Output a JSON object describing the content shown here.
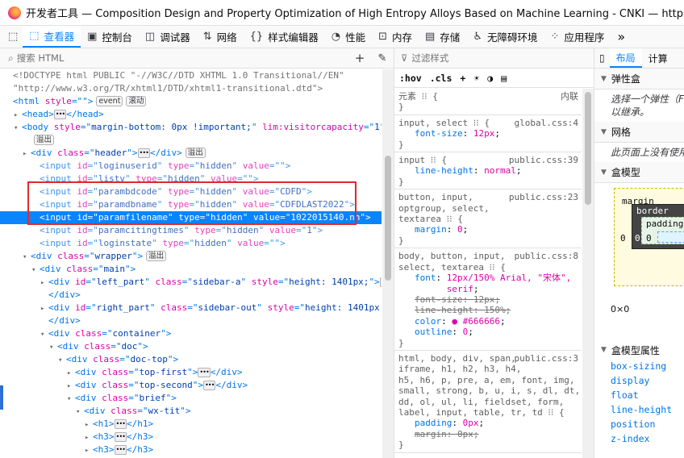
{
  "window": {
    "title": "开发者工具 — Composition Design and Property Optimization of High Entropy Alloys Based on Machine Learning - CNKI — https://ov..."
  },
  "toolbar": {
    "tabs": [
      {
        "label": "查看器",
        "icon": "inspector-icon",
        "active": true
      },
      {
        "label": "控制台",
        "icon": "console-icon"
      },
      {
        "label": "调试器",
        "icon": "debugger-icon"
      },
      {
        "label": "网络",
        "icon": "network-icon"
      },
      {
        "label": "样式编辑器",
        "icon": "style-editor-icon"
      },
      {
        "label": "性能",
        "icon": "performance-icon"
      },
      {
        "label": "内存",
        "icon": "memory-icon"
      },
      {
        "label": "存储",
        "icon": "storage-icon"
      },
      {
        "label": "无障碍环境",
        "icon": "accessibility-icon"
      },
      {
        "label": "应用程序",
        "icon": "application-icon"
      }
    ],
    "overflow": "»"
  },
  "inspector": {
    "search_placeholder": "搜索 HTML",
    "add": "+",
    "lines": [
      {
        "indent": 0,
        "tw": "",
        "parts": [
          [
            "gray",
            "<!DOCTYPE html PUBLIC \"-//W3C//DTD XHTML 1.0 Transitional//EN\""
          ]
        ]
      },
      {
        "indent": 0,
        "tw": "",
        "parts": [
          [
            "gray",
            "\"http://www.w3.org/TR/xhtml1/DTD/xhtml1-transitional.dtd\">"
          ]
        ]
      },
      {
        "indent": 0,
        "tw": "",
        "parts": [
          [
            "tn",
            "<html "
          ],
          [
            "an",
            "style"
          ],
          [
            "tn",
            "=\""
          ],
          [
            "av",
            ""
          ],
          [
            "tn",
            "\">"
          ]
        ],
        "badges": [
          "event",
          "滚动"
        ]
      },
      {
        "indent": 1,
        "tw": "▸",
        "parts": [
          [
            "tn",
            "<head>"
          ]
        ],
        "ell": true,
        "after": [
          [
            "tn",
            "</head>"
          ]
        ]
      },
      {
        "indent": 1,
        "tw": "▾",
        "parts": [
          [
            "tn",
            "<body "
          ],
          [
            "an",
            "style"
          ],
          [
            "tn",
            "=\""
          ],
          [
            "av",
            "margin-bottom: 0px !important;"
          ],
          [
            "tn",
            "\" "
          ],
          [
            "an",
            "lim:visitorcapacity"
          ],
          [
            "tn",
            "=\""
          ],
          [
            "av",
            "1"
          ],
          [
            "tn",
            "\">"
          ]
        ]
      },
      {
        "indent": 2,
        "tw": "",
        "parts": [],
        "badges": [
          "溢出"
        ]
      },
      {
        "indent": 2,
        "tw": "▸",
        "parts": [
          [
            "tn",
            "<div "
          ],
          [
            "an",
            "class"
          ],
          [
            "tn",
            "=\""
          ],
          [
            "av",
            "header"
          ],
          [
            "tn",
            "\">"
          ]
        ],
        "ell": true,
        "after": [
          [
            "tn",
            "</div>"
          ]
        ],
        "badges": [
          "溢出"
        ]
      },
      {
        "indent": 3,
        "tw": "",
        "hid": true,
        "parts": [
          [
            "tn",
            "<input "
          ],
          [
            "an",
            "id"
          ],
          [
            "tn",
            "=\""
          ],
          [
            "av",
            "loginuserid"
          ],
          [
            "tn",
            "\" "
          ],
          [
            "an",
            "type"
          ],
          [
            "tn",
            "=\""
          ],
          [
            "av",
            "hidden"
          ],
          [
            "tn",
            "\" "
          ],
          [
            "an",
            "value"
          ],
          [
            "tn",
            "=\""
          ],
          [
            "av",
            ""
          ],
          [
            "tn",
            "\">"
          ]
        ]
      },
      {
        "indent": 3,
        "tw": "",
        "hid": true,
        "parts": [
          [
            "tn",
            "<input "
          ],
          [
            "an",
            "id"
          ],
          [
            "tn",
            "=\""
          ],
          [
            "av",
            "listv"
          ],
          [
            "tn",
            "\" "
          ],
          [
            "an",
            "type"
          ],
          [
            "tn",
            "=\""
          ],
          [
            "av",
            "hidden"
          ],
          [
            "tn",
            "\" "
          ],
          [
            "an",
            "value"
          ],
          [
            "tn",
            "=\""
          ],
          [
            "av",
            ""
          ],
          [
            "tn",
            "\">"
          ]
        ]
      },
      {
        "indent": 3,
        "tw": "",
        "hid": true,
        "parts": [
          [
            "tn",
            "<input "
          ],
          [
            "an",
            "id"
          ],
          [
            "tn",
            "=\""
          ],
          [
            "av",
            "parambdcode"
          ],
          [
            "tn",
            "\" "
          ],
          [
            "an",
            "type"
          ],
          [
            "tn",
            "=\""
          ],
          [
            "av",
            "hidden"
          ],
          [
            "tn",
            "\" "
          ],
          [
            "an",
            "value"
          ],
          [
            "tn",
            "=\""
          ],
          [
            "av",
            "CDFD"
          ],
          [
            "tn",
            "\">"
          ]
        ]
      },
      {
        "indent": 3,
        "tw": "",
        "hid": true,
        "parts": [
          [
            "tn",
            "<input "
          ],
          [
            "an",
            "id"
          ],
          [
            "tn",
            "=\""
          ],
          [
            "av",
            "paramdbname"
          ],
          [
            "tn",
            "\" "
          ],
          [
            "an",
            "type"
          ],
          [
            "tn",
            "=\""
          ],
          [
            "av",
            "hidden"
          ],
          [
            "tn",
            "\" "
          ],
          [
            "an",
            "value"
          ],
          [
            "tn",
            "=\""
          ],
          [
            "av",
            "CDFDLAST2022"
          ],
          [
            "tn",
            "\">"
          ]
        ]
      },
      {
        "indent": 3,
        "tw": "",
        "sel": true,
        "parts": [
          [
            "tn",
            "<input "
          ],
          [
            "an",
            "id"
          ],
          [
            "tn",
            "=\""
          ],
          [
            "av",
            "paramfilename"
          ],
          [
            "tn",
            "\" "
          ],
          [
            "an",
            "type"
          ],
          [
            "tn",
            "=\""
          ],
          [
            "av",
            "hidden"
          ],
          [
            "tn",
            "\" "
          ],
          [
            "an",
            "value"
          ],
          [
            "tn",
            "=\""
          ],
          [
            "av",
            "1022015140.nh"
          ],
          [
            "tn",
            "\">"
          ]
        ]
      },
      {
        "indent": 3,
        "tw": "",
        "hid": true,
        "parts": [
          [
            "tn",
            "<input "
          ],
          [
            "an",
            "id"
          ],
          [
            "tn",
            "=\""
          ],
          [
            "av",
            "paramcitingtimes"
          ],
          [
            "tn",
            "\" "
          ],
          [
            "an",
            "type"
          ],
          [
            "tn",
            "=\""
          ],
          [
            "av",
            "hidden"
          ],
          [
            "tn",
            "\" "
          ],
          [
            "an",
            "value"
          ],
          [
            "tn",
            "=\""
          ],
          [
            "av",
            "1"
          ],
          [
            "tn",
            "\">"
          ]
        ]
      },
      {
        "indent": 3,
        "tw": "",
        "hid": true,
        "parts": [
          [
            "tn",
            "<input "
          ],
          [
            "an",
            "id"
          ],
          [
            "tn",
            "=\""
          ],
          [
            "av",
            "loginstate"
          ],
          [
            "tn",
            "\" "
          ],
          [
            "an",
            "type"
          ],
          [
            "tn",
            "=\""
          ],
          [
            "av",
            "hidden"
          ],
          [
            "tn",
            "\" "
          ],
          [
            "an",
            "value"
          ],
          [
            "tn",
            "=\""
          ],
          [
            "av",
            ""
          ],
          [
            "tn",
            "\">"
          ]
        ]
      },
      {
        "indent": 2,
        "tw": "▾",
        "parts": [
          [
            "tn",
            "<div "
          ],
          [
            "an",
            "class"
          ],
          [
            "tn",
            "=\""
          ],
          [
            "av",
            "wrapper"
          ],
          [
            "tn",
            "\">"
          ]
        ],
        "badges": [
          "溢出"
        ]
      },
      {
        "indent": 3,
        "tw": "▾",
        "parts": [
          [
            "tn",
            "<div "
          ],
          [
            "an",
            "class"
          ],
          [
            "tn",
            "=\""
          ],
          [
            "av",
            "main"
          ],
          [
            "tn",
            "\">"
          ]
        ]
      },
      {
        "indent": 4,
        "tw": "▸",
        "parts": [
          [
            "tn",
            "<div "
          ],
          [
            "an",
            "id"
          ],
          [
            "tn",
            "=\""
          ],
          [
            "av",
            "left_part"
          ],
          [
            "tn",
            "\" "
          ],
          [
            "an",
            "class"
          ],
          [
            "tn",
            "=\""
          ],
          [
            "av",
            "sidebar-a"
          ],
          [
            "tn",
            "\" "
          ],
          [
            "an",
            "style"
          ],
          [
            "tn",
            "=\""
          ],
          [
            "av",
            "height: 1401px;"
          ],
          [
            "tn",
            "\">"
          ]
        ],
        "ell": true
      },
      {
        "indent": 4,
        "tw": "",
        "parts": [
          [
            "tn",
            "</div>"
          ]
        ]
      },
      {
        "indent": 4,
        "tw": "▸",
        "parts": [
          [
            "tn",
            "<div "
          ],
          [
            "an",
            "id"
          ],
          [
            "tn",
            "=\""
          ],
          [
            "av",
            "right_part"
          ],
          [
            "tn",
            "\" "
          ],
          [
            "an",
            "class"
          ],
          [
            "tn",
            "=\""
          ],
          [
            "av",
            "sidebar-out"
          ],
          [
            "tn",
            "\" "
          ],
          [
            "an",
            "style"
          ],
          [
            "tn",
            "=\""
          ],
          [
            "av",
            "height: 1401px;"
          ],
          [
            "tn",
            "\">"
          ]
        ],
        "ell": true
      },
      {
        "indent": 4,
        "tw": "",
        "parts": [
          [
            "tn",
            "</div>"
          ]
        ]
      },
      {
        "indent": 4,
        "tw": "▾",
        "parts": [
          [
            "tn",
            "<div "
          ],
          [
            "an",
            "class"
          ],
          [
            "tn",
            "=\""
          ],
          [
            "av",
            "container"
          ],
          [
            "tn",
            "\">"
          ]
        ]
      },
      {
        "indent": 5,
        "tw": "▾",
        "parts": [
          [
            "tn",
            "<div "
          ],
          [
            "an",
            "class"
          ],
          [
            "tn",
            "=\""
          ],
          [
            "av",
            "doc"
          ],
          [
            "tn",
            "\">"
          ]
        ]
      },
      {
        "indent": 6,
        "tw": "▾",
        "parts": [
          [
            "tn",
            "<div "
          ],
          [
            "an",
            "class"
          ],
          [
            "tn",
            "=\""
          ],
          [
            "av",
            "doc-top"
          ],
          [
            "tn",
            "\">"
          ]
        ]
      },
      {
        "indent": 7,
        "tw": "▸",
        "parts": [
          [
            "tn",
            "<div "
          ],
          [
            "an",
            "class"
          ],
          [
            "tn",
            "=\""
          ],
          [
            "av",
            "top-first"
          ],
          [
            "tn",
            "\">"
          ]
        ],
        "ell": true,
        "after": [
          [
            "tn",
            "</div>"
          ]
        ]
      },
      {
        "indent": 7,
        "tw": "▸",
        "parts": [
          [
            "tn",
            "<div "
          ],
          [
            "an",
            "class"
          ],
          [
            "tn",
            "=\""
          ],
          [
            "av",
            "top-second"
          ],
          [
            "tn",
            "\">"
          ]
        ],
        "ell": true,
        "after": [
          [
            "tn",
            "</div>"
          ]
        ]
      },
      {
        "indent": 7,
        "tw": "▾",
        "parts": [
          [
            "tn",
            "<div "
          ],
          [
            "an",
            "class"
          ],
          [
            "tn",
            "=\""
          ],
          [
            "av",
            "brief"
          ],
          [
            "tn",
            "\">"
          ]
        ]
      },
      {
        "indent": 8,
        "tw": "▾",
        "parts": [
          [
            "tn",
            "<div "
          ],
          [
            "an",
            "class"
          ],
          [
            "tn",
            "=\""
          ],
          [
            "av",
            "wx-tit"
          ],
          [
            "tn",
            "\">"
          ]
        ]
      },
      {
        "indent": 9,
        "tw": "▸",
        "parts": [
          [
            "tn",
            "<h1>"
          ]
        ],
        "ell": true,
        "after": [
          [
            "tn",
            "</h1>"
          ]
        ]
      },
      {
        "indent": 9,
        "tw": "▸",
        "parts": [
          [
            "tn",
            "<h3>"
          ]
        ],
        "ell": true,
        "after": [
          [
            "tn",
            "</h3>"
          ]
        ]
      },
      {
        "indent": 9,
        "tw": "▸",
        "parts": [
          [
            "tn",
            "<h3>"
          ]
        ],
        "ell": true,
        "after": [
          [
            "tn",
            "</h3>"
          ]
        ]
      },
      {
        "indent": 8,
        "tw": "",
        "parts": [
          [
            "tn",
            "</div>"
          ]
        ]
      }
    ]
  },
  "rules": {
    "filter_placeholder": "过滤样式",
    "tools": [
      ":hov",
      ".cls",
      "+",
      "☀",
      "◑",
      "▤"
    ],
    "blocks": [
      {
        "selector": "元素 ⁝⁝ {",
        "source": "内联",
        "props": [],
        "close": "}"
      },
      {
        "selector": "input, select ⁝⁝ {",
        "source": "global.css:4",
        "props": [
          {
            "n": "font-size",
            "v": "12px"
          }
        ],
        "close": "}"
      },
      {
        "selector": "input ⁝⁝ {",
        "source": "public.css:39",
        "props": [
          {
            "n": "line-height",
            "v": "normal"
          }
        ],
        "close": "}"
      },
      {
        "selector": "button, input,\noptgroup, select,\ntextarea ⁝⁝ {",
        "source": "public.css:23",
        "props": [
          {
            "n": "margin",
            "v": "0"
          }
        ],
        "close": "}"
      },
      {
        "selector": "body, button, input,\nselect, textarea ⁝⁝ {",
        "source": "public.css:8",
        "props": [
          {
            "n": "font",
            "v": "12px/150% Arial, \"宋体\",\n      serif"
          },
          {
            "n": "font-size",
            "v": "12px",
            "strike": true
          },
          {
            "n": "line-height",
            "v": "150%",
            "strike": true
          },
          {
            "n": "color",
            "v": "● #666666"
          },
          {
            "n": "outline",
            "v": "0"
          }
        ],
        "close": "}"
      },
      {
        "selector": "html, body, div, span,\niframe, h1, h2, h3, h4,\nh5, h6, p, pre, a, em, font, img,\nsmall, strong, b, u, i, s, dl, dt,\ndd, ol, ul, li, fieldset, form,\nlabel, input, table, tr, td ⁝⁝ {",
        "source": "public.css:3",
        "props": [
          {
            "n": "padding",
            "v": "0px"
          },
          {
            "n": "margin",
            "v": "0px",
            "strike": true
          }
        ],
        "close": "}"
      }
    ]
  },
  "layoutpanel": {
    "tabs": [
      "布局",
      "计算"
    ],
    "sections": [
      "弹性盒",
      "网格",
      "盒模型"
    ],
    "flex_note": "选择一个弹性（F…\n以继承。",
    "grid_note": "此页面上没有使用…",
    "boxmodel": {
      "margin": "margin",
      "border": "border",
      "padding": "padding",
      "margin_left": "0",
      "border_left": "0",
      "padding_left": "0",
      "size": "0×0"
    },
    "props_title": "盒模型属性",
    "props": [
      "box-sizing",
      "display",
      "float",
      "line-height",
      "position",
      "z-index"
    ]
  }
}
